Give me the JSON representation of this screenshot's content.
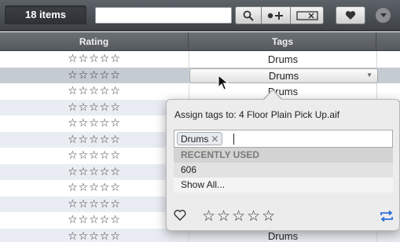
{
  "toolbar": {
    "items_count": "18 items",
    "search_value": "",
    "icons": [
      "search-icon",
      "add-tag-icon",
      "clear-tag-icon",
      "heart-icon",
      "menu-chevron-icon"
    ]
  },
  "columns": {
    "rating": "Rating",
    "tags": "Tags"
  },
  "rows": [
    {
      "stars": "☆☆☆☆☆",
      "tag": "Drums",
      "selected": false
    },
    {
      "stars": "☆☆☆☆☆",
      "tag": "Drums",
      "selected": true
    },
    {
      "stars": "☆☆☆☆☆",
      "tag": "Drums",
      "selected": false
    },
    {
      "stars": "☆☆☆☆☆",
      "tag": "",
      "selected": false
    },
    {
      "stars": "☆☆☆☆☆",
      "tag": "",
      "selected": false
    },
    {
      "stars": "☆☆☆☆☆",
      "tag": "",
      "selected": false
    },
    {
      "stars": "☆☆☆☆☆",
      "tag": "",
      "selected": false
    },
    {
      "stars": "☆☆☆☆☆",
      "tag": "",
      "selected": false
    },
    {
      "stars": "☆☆☆☆☆",
      "tag": "",
      "selected": false
    },
    {
      "stars": "☆☆☆☆☆",
      "tag": "",
      "selected": false
    },
    {
      "stars": "☆☆☆☆☆",
      "tag": "",
      "selected": false
    },
    {
      "stars": "☆☆☆☆☆",
      "tag": "Drums",
      "selected": false
    }
  ],
  "popover": {
    "title": "Assign tags to: 4 Floor Plain Pick Up.aif",
    "tag_chip": "Drums",
    "chip_remove": "✕",
    "section_header": "RECENTLY USED",
    "suggestions": [
      "606",
      "Show All..."
    ],
    "rating_stars": "☆☆☆☆☆",
    "accent_color": "#2f6fd6"
  },
  "colors": {
    "toolbar_bg": "#4b4f54",
    "row_alt": "#e9edf3",
    "row_selected": "#c5cbd3"
  }
}
